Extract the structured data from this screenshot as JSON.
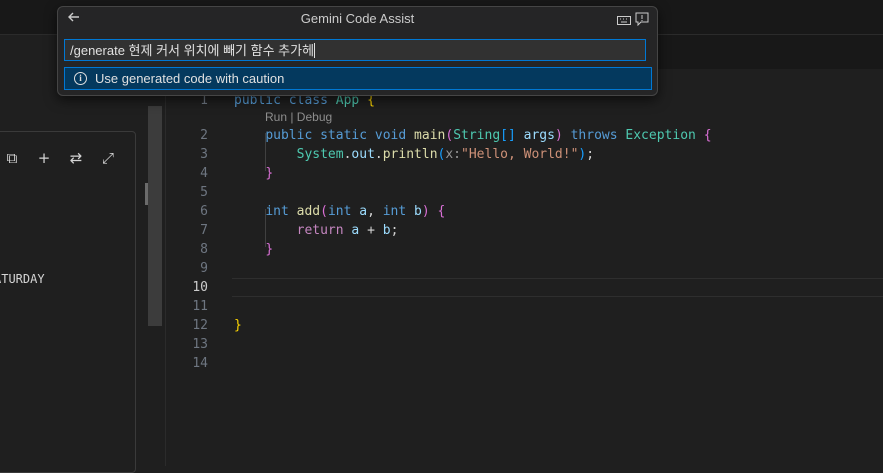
{
  "dialog": {
    "title": "Gemini Code Assist",
    "back_icon": "arrow-left-icon",
    "keyboard_icon": "keyboard-icon",
    "feedback_icon": "feedback-icon",
    "input_value": "/generate 현제 커서 위치에 빼기 함수 추가헤",
    "info_icon": "info-icon",
    "info_message": "Use generated code with caution"
  },
  "side_panel": {
    "tools": [
      "copy-icon",
      "plus-icon",
      "collapse-icon",
      "expand-icon"
    ],
    "glyphs": [
      "⧉",
      "+",
      "⇄",
      "⤢"
    ],
    "text": "ATURDAY"
  },
  "editor": {
    "codelens": "Run | Debug",
    "active_line": "10",
    "lines": [
      {
        "n": "1",
        "t": [
          [
            "public",
            "k1"
          ],
          [
            " ",
            "pu"
          ],
          [
            "class",
            "k1"
          ],
          [
            " ",
            "pu"
          ],
          [
            "App",
            "ty"
          ],
          [
            " ",
            "pu"
          ],
          [
            "{",
            "b1"
          ]
        ]
      },
      {
        "n": "2",
        "t": [
          [
            "    ",
            "pu"
          ],
          [
            "public",
            "k1"
          ],
          [
            " ",
            "pu"
          ],
          [
            "static",
            "k1"
          ],
          [
            " ",
            "pu"
          ],
          [
            "void",
            "k1"
          ],
          [
            " ",
            "pu"
          ],
          [
            "main",
            "fn"
          ],
          [
            "(",
            "b2"
          ],
          [
            "String",
            "ty"
          ],
          [
            "[]",
            "b3"
          ],
          [
            " ",
            "pu"
          ],
          [
            "args",
            "va"
          ],
          [
            ")",
            "b2"
          ],
          [
            " ",
            "pu"
          ],
          [
            "throws",
            "k1"
          ],
          [
            " ",
            "pu"
          ],
          [
            "Exception",
            "ty"
          ],
          [
            " ",
            "pu"
          ],
          [
            "{",
            "b2"
          ]
        ]
      },
      {
        "n": "3",
        "t": [
          [
            "        ",
            "pu"
          ],
          [
            "System",
            "ty"
          ],
          [
            ".",
            "pu"
          ],
          [
            "out",
            "va"
          ],
          [
            ".",
            "pu"
          ],
          [
            "println",
            "fn"
          ],
          [
            "(",
            "b3"
          ],
          [
            "x:",
            "hint"
          ],
          [
            "\"Hello, World!\"",
            "st"
          ],
          [
            ")",
            "b3"
          ],
          [
            ";",
            "pu"
          ]
        ]
      },
      {
        "n": "4",
        "t": [
          [
            "    ",
            "pu"
          ],
          [
            "}",
            "b2"
          ]
        ]
      },
      {
        "n": "5",
        "t": []
      },
      {
        "n": "6",
        "t": [
          [
            "    ",
            "pu"
          ],
          [
            "int",
            "k1"
          ],
          [
            " ",
            "pu"
          ],
          [
            "add",
            "fn"
          ],
          [
            "(",
            "b2"
          ],
          [
            "int",
            "k1"
          ],
          [
            " ",
            "pu"
          ],
          [
            "a",
            "va"
          ],
          [
            ", ",
            "pu"
          ],
          [
            "int",
            "k1"
          ],
          [
            " ",
            "pu"
          ],
          [
            "b",
            "va"
          ],
          [
            ")",
            "b2"
          ],
          [
            " ",
            "pu"
          ],
          [
            "{",
            "b2"
          ]
        ]
      },
      {
        "n": "7",
        "t": [
          [
            "        ",
            "pu"
          ],
          [
            "return",
            "k2"
          ],
          [
            " ",
            "pu"
          ],
          [
            "a",
            "va"
          ],
          [
            " + ",
            "pu"
          ],
          [
            "b",
            "va"
          ],
          [
            ";",
            "pu"
          ]
        ]
      },
      {
        "n": "8",
        "t": [
          [
            "    ",
            "pu"
          ],
          [
            "}",
            "b2"
          ]
        ]
      },
      {
        "n": "9",
        "t": []
      },
      {
        "n": "10",
        "t": []
      },
      {
        "n": "11",
        "t": []
      },
      {
        "n": "12",
        "t": [
          [
            "}",
            "b1"
          ]
        ]
      },
      {
        "n": "13",
        "t": []
      },
      {
        "n": "14",
        "t": []
      }
    ]
  }
}
